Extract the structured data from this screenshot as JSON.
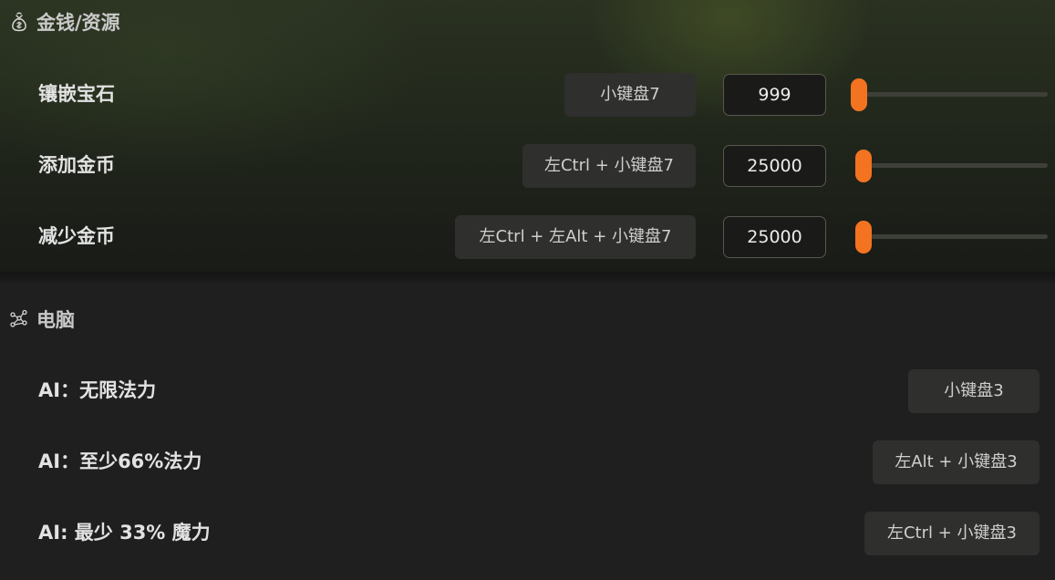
{
  "colors": {
    "accent": "#f47321",
    "section_title": "#c9c9c9",
    "label": "#e2e2e2",
    "hotkey_bg": "#2f2f2e"
  },
  "sections": [
    {
      "icon": "money-bag-icon",
      "title": "金钱/资源",
      "rows": [
        {
          "label": "镶嵌宝石",
          "hotkey": "小键盘7",
          "value": "999",
          "slider_level": 0.0
        },
        {
          "label": "添加金币",
          "hotkey": "左Ctrl + 小键盘7",
          "value": "25000",
          "slider_level": 0.02
        },
        {
          "label": "减少金币",
          "hotkey": "左Ctrl + 左Alt + 小键盘7",
          "value": "25000",
          "slider_level": 0.02
        }
      ]
    },
    {
      "icon": "network-icon",
      "title": "电脑",
      "rows": [
        {
          "label": "AI：无限法力",
          "hotkey": "小键盘3"
        },
        {
          "label": "AI：至少66%法力",
          "hotkey": "左Alt + 小键盘3"
        },
        {
          "label": "AI: 最少 33% 魔力",
          "hotkey": "左Ctrl + 小键盘3"
        }
      ]
    }
  ]
}
